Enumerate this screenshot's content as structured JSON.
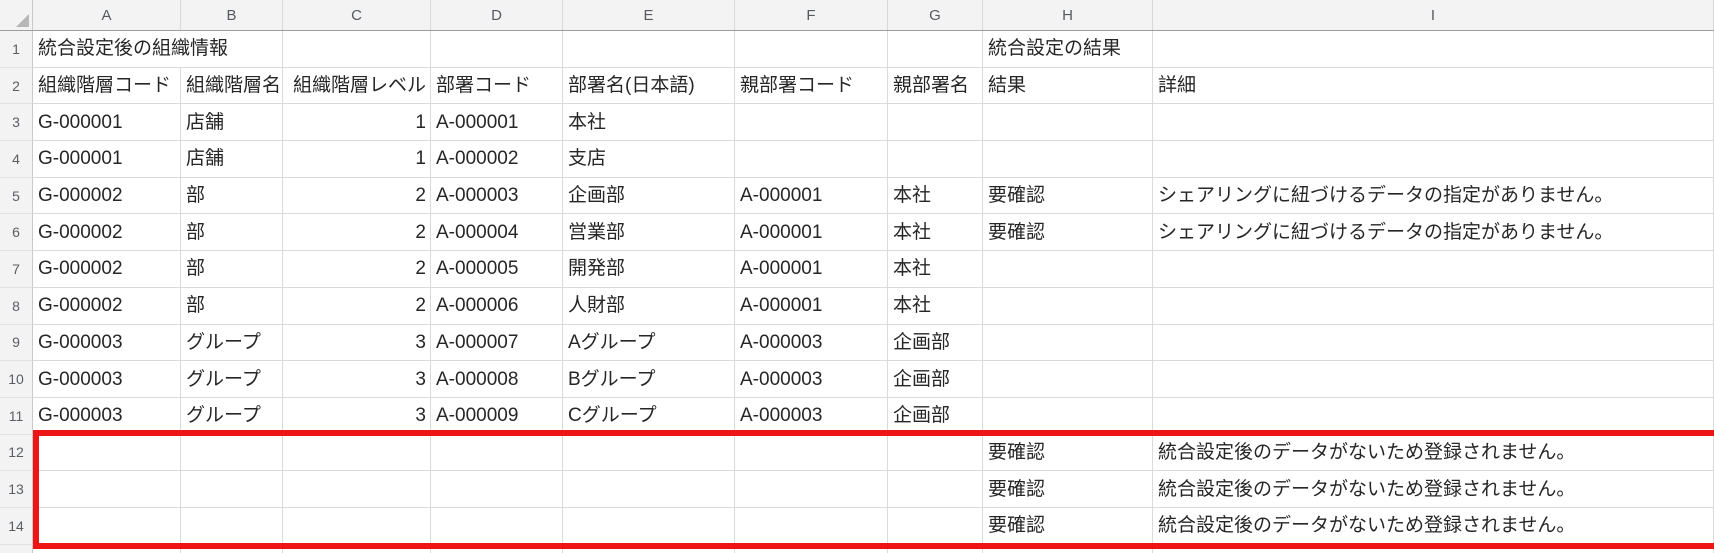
{
  "sheet": {
    "column_letters": [
      "A",
      "B",
      "C",
      "D",
      "E",
      "F",
      "G",
      "H",
      "I"
    ],
    "numeric_column_indexes": [
      2
    ],
    "rows": [
      {
        "num": "1",
        "cells": [
          "統合設定後の組織情報",
          "",
          "",
          "",
          "",
          "",
          "",
          "統合設定の結果",
          ""
        ]
      },
      {
        "num": "2",
        "cells": [
          "組織階層コード",
          "組織階層名",
          "組織階層レベル",
          "部署コード",
          "部署名(日本語)",
          "親部署コード",
          "親部署名",
          "結果",
          "詳細"
        ]
      },
      {
        "num": "3",
        "cells": [
          "G-000001",
          "店舗",
          "1",
          "A-000001",
          "本社",
          "",
          "",
          "",
          ""
        ]
      },
      {
        "num": "4",
        "cells": [
          "G-000001",
          "店舗",
          "1",
          "A-000002",
          "支店",
          "",
          "",
          "",
          ""
        ]
      },
      {
        "num": "5",
        "cells": [
          "G-000002",
          "部",
          "2",
          "A-000003",
          "企画部",
          "A-000001",
          "本社",
          "要確認",
          "シェアリングに紐づけるデータの指定がありません。"
        ]
      },
      {
        "num": "6",
        "cells": [
          "G-000002",
          "部",
          "2",
          "A-000004",
          "営業部",
          "A-000001",
          "本社",
          "要確認",
          "シェアリングに紐づけるデータの指定がありません。"
        ]
      },
      {
        "num": "7",
        "cells": [
          "G-000002",
          "部",
          "2",
          "A-000005",
          "開発部",
          "A-000001",
          "本社",
          "",
          ""
        ]
      },
      {
        "num": "8",
        "cells": [
          "G-000002",
          "部",
          "2",
          "A-000006",
          "人財部",
          "A-000001",
          "本社",
          "",
          ""
        ]
      },
      {
        "num": "9",
        "cells": [
          "G-000003",
          "グループ",
          "3",
          "A-000007",
          "Aグループ",
          "A-000003",
          "企画部",
          "",
          ""
        ]
      },
      {
        "num": "10",
        "cells": [
          "G-000003",
          "グループ",
          "3",
          "A-000008",
          "Bグループ",
          "A-000003",
          "企画部",
          "",
          ""
        ]
      },
      {
        "num": "11",
        "cells": [
          "G-000003",
          "グループ",
          "3",
          "A-000009",
          "Cグループ",
          "A-000003",
          "企画部",
          "",
          ""
        ]
      },
      {
        "num": "12",
        "cells": [
          "",
          "",
          "",
          "",
          "",
          "",
          "",
          "要確認",
          "統合設定後のデータがないため登録されません。"
        ]
      },
      {
        "num": "13",
        "cells": [
          "",
          "",
          "",
          "",
          "",
          "",
          "",
          "要確認",
          "統合設定後のデータがないため登録されません。"
        ]
      },
      {
        "num": "14",
        "cells": [
          "",
          "",
          "",
          "",
          "",
          "",
          "",
          "要確認",
          "統合設定後のデータがないため登録されません。"
        ]
      }
    ],
    "red_box": {
      "first_row": "12",
      "last_row": "14"
    }
  },
  "colors": {
    "red_border": "#ed1515",
    "gridline": "#dadada",
    "header_bg": "#f3f3f3",
    "cell_text": "#262626"
  }
}
